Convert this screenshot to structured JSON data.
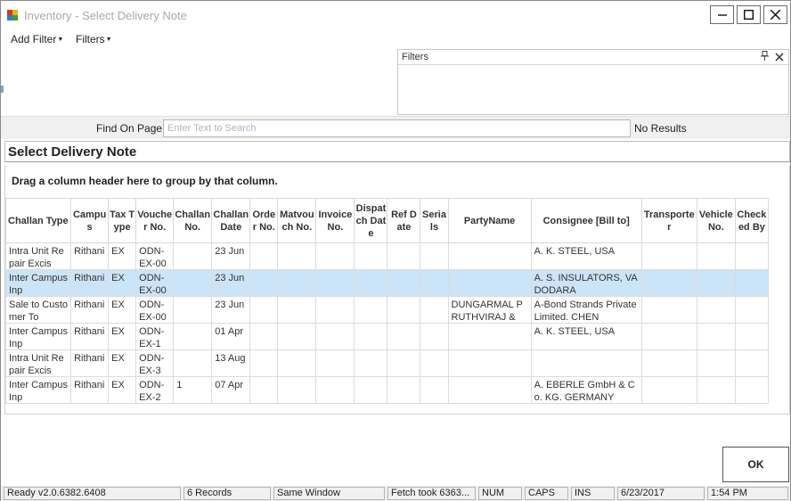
{
  "window": {
    "title": "Inventory - Select Delivery Note"
  },
  "menu": {
    "add_filter": "Add Filter",
    "filters": "Filters"
  },
  "filters_panel": {
    "title": "Filters"
  },
  "find": {
    "label": "Find On Page",
    "placeholder": "Enter Text to Search",
    "result": "No Results"
  },
  "grid": {
    "title": "Select Delivery Note",
    "group_hint": "Drag a column header here to group by that column.",
    "columns": [
      "Challan Type",
      "Campus",
      "Tax Type",
      "Voucher No.",
      "Challan No.",
      "Challan Date",
      "Order No.",
      "Matvouch No.",
      "Invoice No.",
      "Dispatch Date",
      "Ref Date",
      "Serials",
      "PartyName",
      "Consignee [Bill to]",
      "Transporter",
      "Vehicle No.",
      "Checked By"
    ],
    "rows": [
      {
        "challan_type": "Intra Unit Repair Excis",
        "campus": "Rithani",
        "tax_type": "EX",
        "voucher": "ODN-EX-00",
        "challan_no": "",
        "challan_date": "23 Jun",
        "party": "",
        "consignee": "A. K. STEEL, USA",
        "selected": false
      },
      {
        "challan_type": "Inter Campus Inp",
        "campus": "Rithani",
        "tax_type": "EX",
        "voucher": "ODN-EX-00",
        "challan_no": "",
        "challan_date": "23 Jun",
        "party": "",
        "consignee": "A. S. INSULATORS, VADODARA",
        "selected": true
      },
      {
        "challan_type": "Sale to Customer To",
        "campus": "Rithani",
        "tax_type": "EX",
        "voucher": "ODN-EX-00",
        "challan_no": "",
        "challan_date": "23 Jun",
        "party": "DUNGARMAL PRUTHVIRAJ &",
        "consignee": "A-Bond Strands Private Limited. CHEN",
        "selected": false
      },
      {
        "challan_type": "Inter Campus Inp",
        "campus": "Rithani",
        "tax_type": "EX",
        "voucher": "ODN-EX-1",
        "challan_no": "",
        "challan_date": "01 Apr",
        "party": "",
        "consignee": "A. K. STEEL, USA",
        "selected": false
      },
      {
        "challan_type": "Intra Unit Repair Excis",
        "campus": "Rithani",
        "tax_type": "EX",
        "voucher": "ODN-EX-3",
        "challan_no": "",
        "challan_date": "13 Aug",
        "party": "",
        "consignee": "",
        "selected": false
      },
      {
        "challan_type": "Inter Campus Inp",
        "campus": "Rithani",
        "tax_type": "EX",
        "voucher": "ODN-EX-2",
        "challan_no": "1",
        "challan_date": "07 Apr",
        "party": "",
        "consignee": "A. EBERLE GmbH & Co. KG. GERMANY",
        "selected": false
      }
    ]
  },
  "ok_button": "OK",
  "status": {
    "ready": "Ready v2.0.6382.6408",
    "records": "6 Records",
    "window_mode": "Same Window",
    "fetch": "Fetch took 6363...",
    "num": "NUM",
    "caps": "CAPS",
    "ins": "INS",
    "date": "6/23/2017",
    "time": "1:54 PM"
  },
  "colors": {
    "selected_row": "#cce4f7",
    "title_text": "#a9a9a9"
  },
  "icons": {
    "app": "inventory-app-icon",
    "minimize": "minimize-icon",
    "maximize": "maximize-icon",
    "close": "close-icon",
    "pin": "pin-icon",
    "panel_close": "close-icon"
  }
}
